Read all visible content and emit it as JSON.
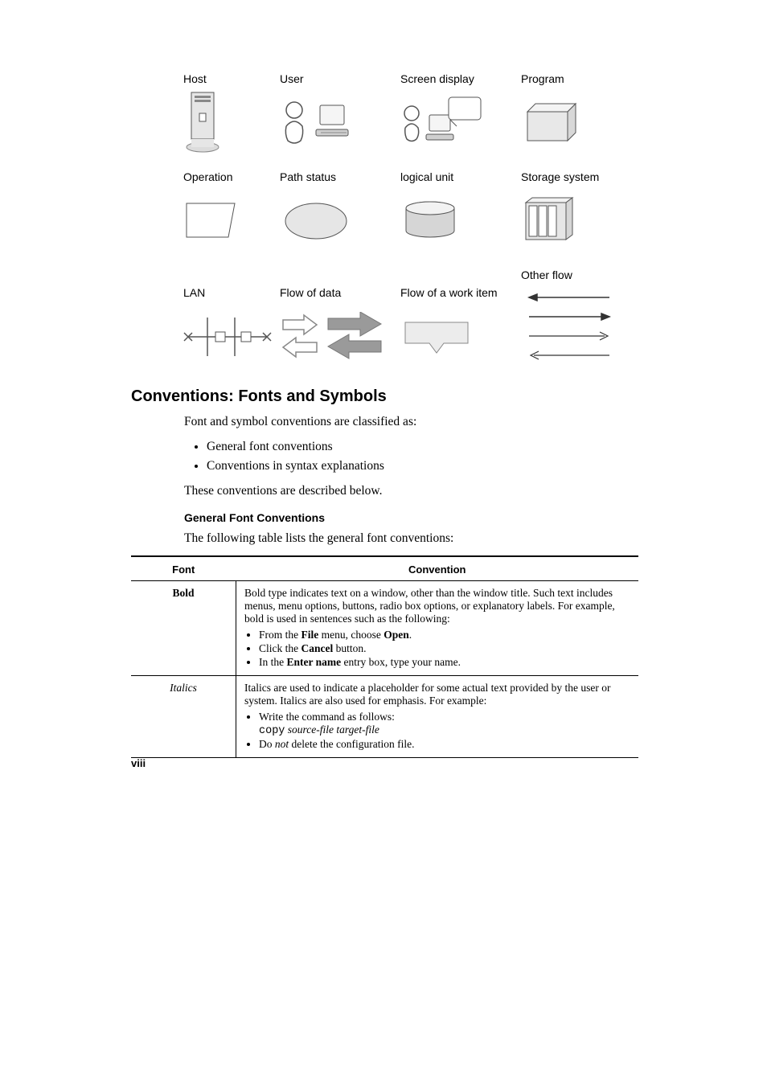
{
  "figure": {
    "row1": {
      "c1": "Host",
      "c2": "User",
      "c3": "Screen display",
      "c4": "Program"
    },
    "row2": {
      "c1": "Operation",
      "c2": "Path status",
      "c3": "logical unit",
      "c4": "Storage system"
    },
    "row3": {
      "c1": "LAN",
      "c2": "Flow of data",
      "c3": "Flow of a work item",
      "c4": "Other flow"
    }
  },
  "section": {
    "heading": "Conventions: Fonts and Symbols",
    "intro": "Font and symbol conventions are classified as:",
    "bullets": [
      "General font conventions",
      "Conventions in syntax explanations"
    ],
    "closing": "These conventions are described below.",
    "sub_heading": "General Font Conventions",
    "sub_intro": "The following table lists the general font conventions:"
  },
  "table": {
    "head": {
      "col1": "Font",
      "col2": "Convention"
    },
    "row_bold": {
      "label": "Bold",
      "desc": "Bold type indicates text on a window, other than the window title. Such text includes menus, menu options, buttons, radio box options, or explanatory labels. For example, bold is used in sentences such as the following:",
      "items": {
        "a_pre": "From the ",
        "a_b1": "File",
        "a_mid": " menu, choose ",
        "a_b2": "Open",
        "a_post": ".",
        "b_pre": "Click the ",
        "b_b": "Cancel",
        "b_post": " button.",
        "c_pre": "In the ",
        "c_b": "Enter name",
        "c_post": " entry box, type your name."
      }
    },
    "row_italics": {
      "label": "Italics",
      "desc": "Italics are used to indicate a placeholder for some actual text provided by the user or system. Italics are also used for emphasis. For example:",
      "items": {
        "a_pre": "Write the command as follows:",
        "a_cmd_mono": "copy",
        "a_cmd_it": " source-file target-file",
        "b_pre": "Do ",
        "b_it": "not",
        "b_post": " delete the configuration file."
      }
    }
  },
  "page_number": "viii"
}
